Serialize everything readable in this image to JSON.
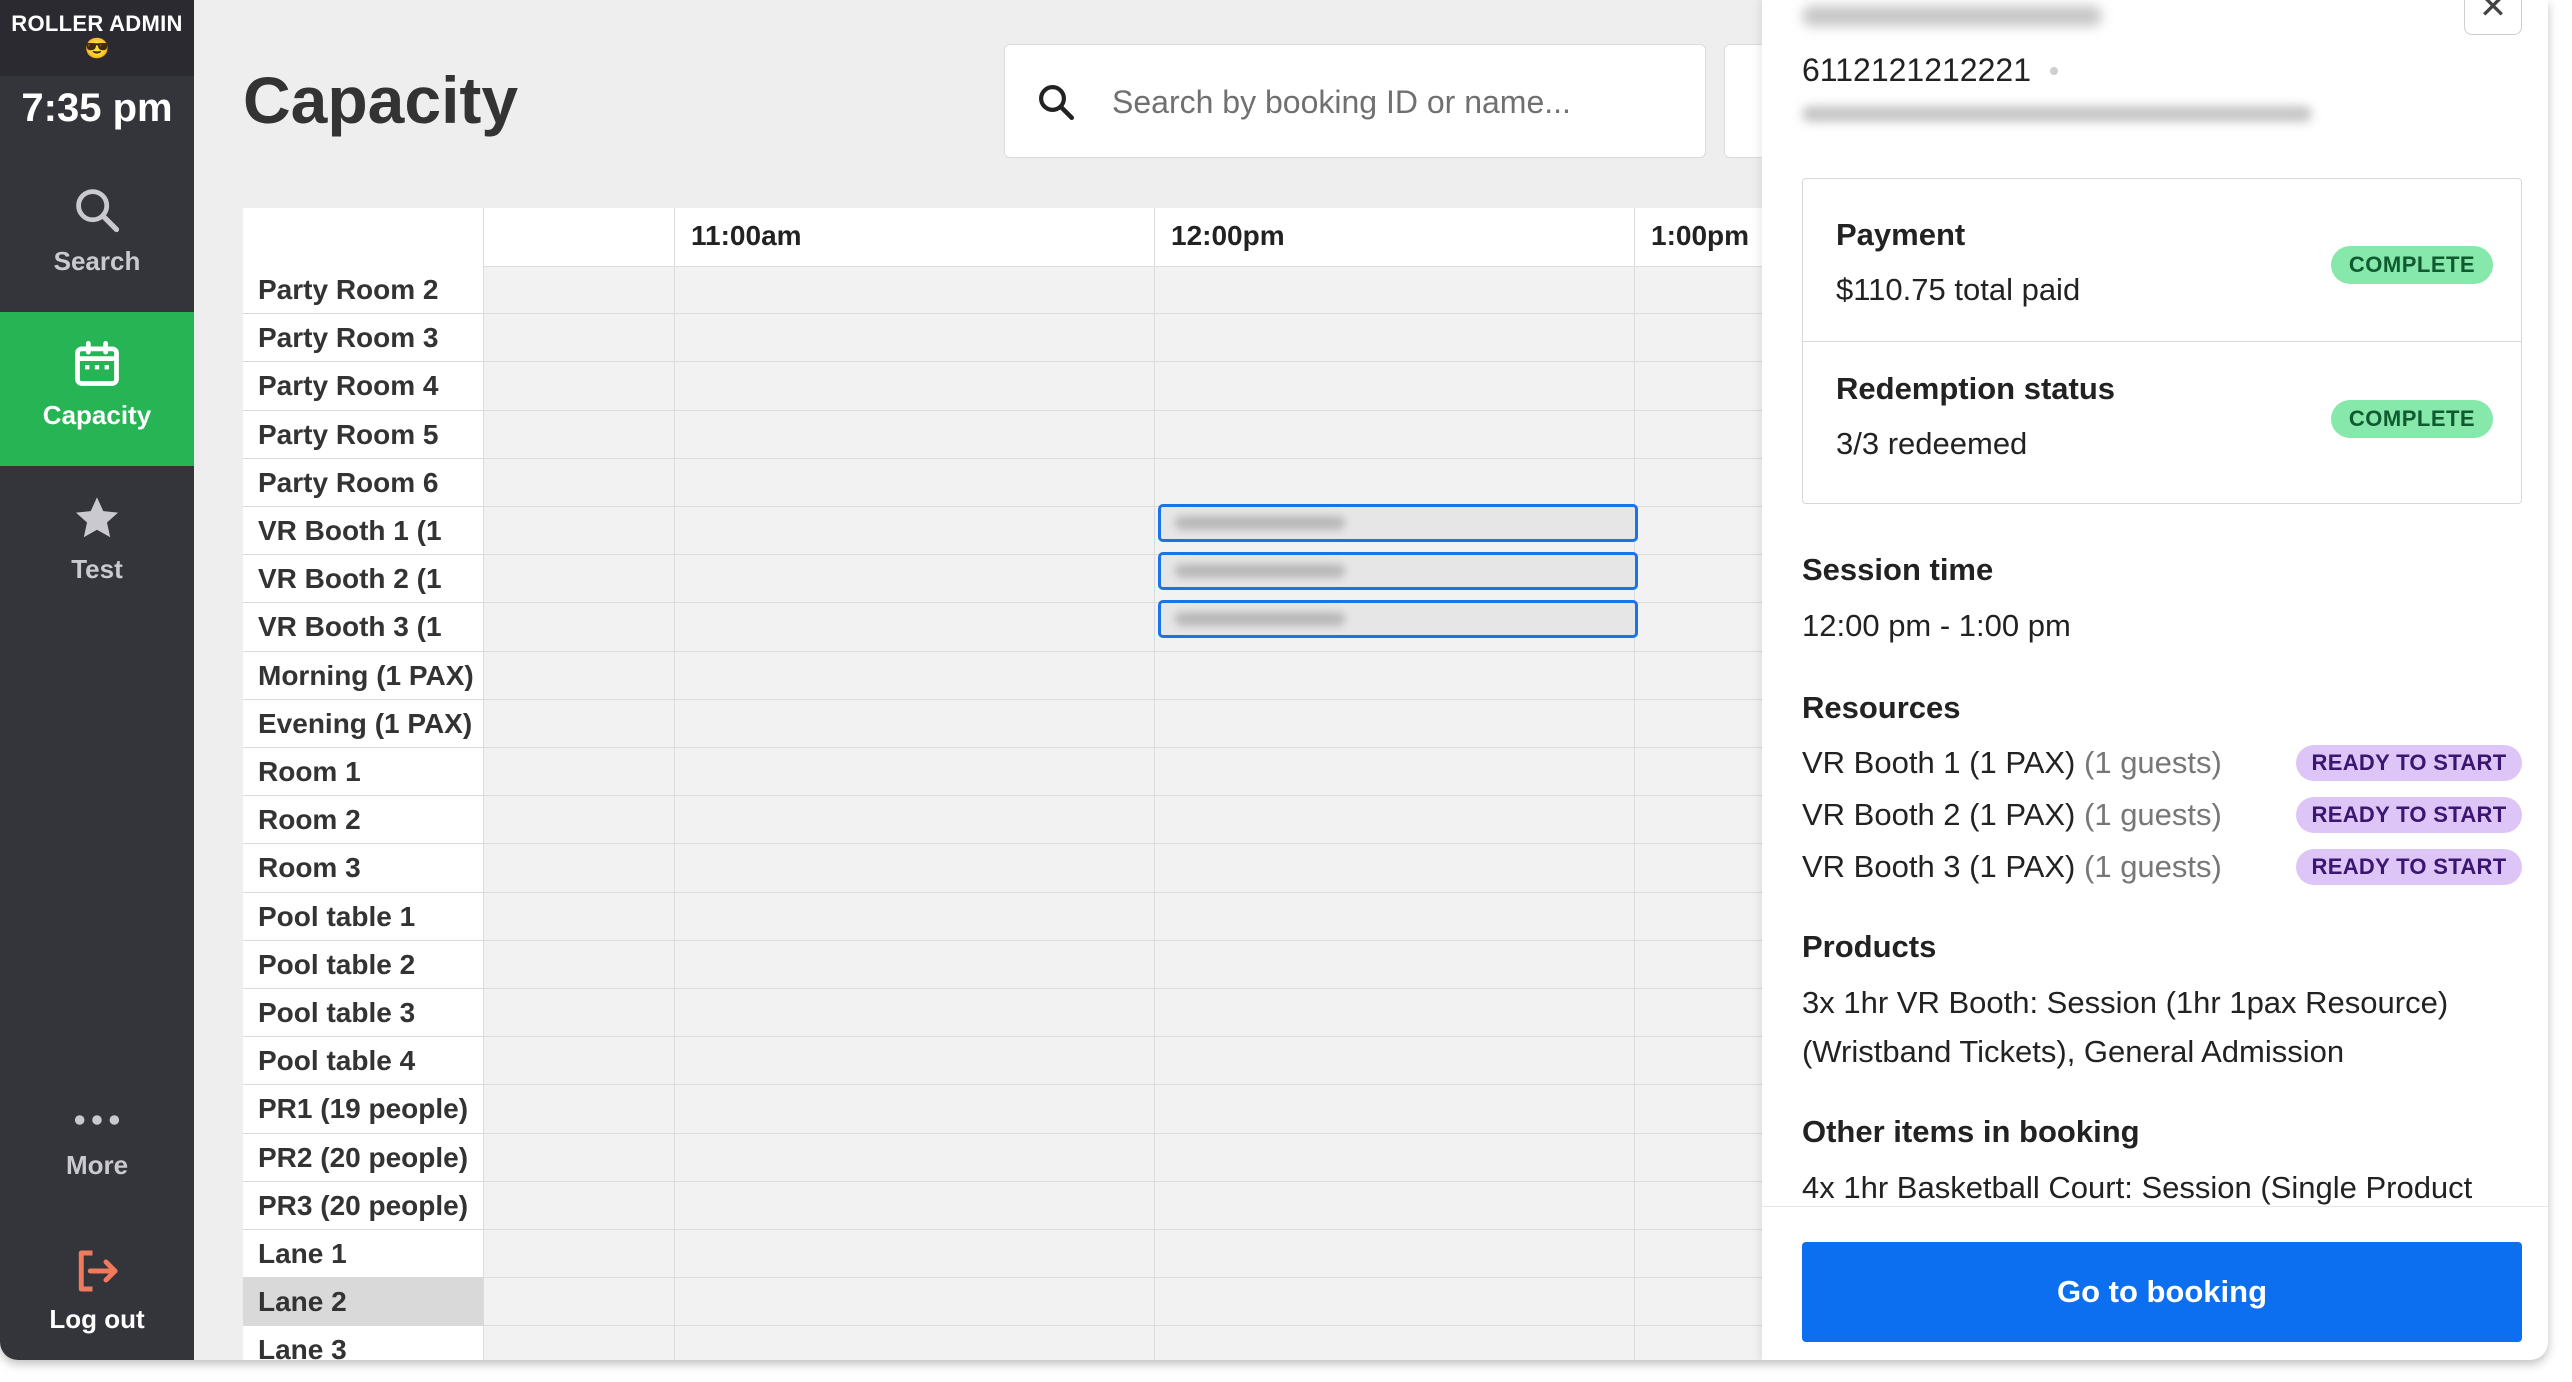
{
  "sidebar": {
    "brand": "ROLLER ADMIN",
    "brand_emoji": "😎",
    "time": "7:35 pm",
    "nav": {
      "search": "Search",
      "capacity": "Capacity",
      "test": "Test",
      "more": "More",
      "logout": "Log out"
    }
  },
  "header": {
    "title": "Capacity",
    "search_placeholder": "Search by booking ID or name..."
  },
  "grid": {
    "time_labels": [
      "11:00am",
      "12:00pm",
      "1:00pm"
    ],
    "rows": [
      "Party Room 2",
      "Party Room 3",
      "Party Room 4",
      "Party Room 5",
      "Party Room 6",
      "VR Booth 1 (1",
      "VR Booth 2 (1",
      "VR Booth 3 (1",
      "Morning (1 PAX)",
      "Evening (1 PAX)",
      "Room 1",
      "Room 2",
      "Room 3",
      "Pool table 1",
      "Pool table 2",
      "Pool table 3",
      "Pool table 4",
      "PR1 (19 people)",
      "PR2 (20 people)",
      "PR3 (20 people)",
      "Lane 1",
      "Lane 2",
      "Lane 3"
    ]
  },
  "panel": {
    "booking_id": "6112121212221",
    "payment_title": "Payment",
    "payment_value": "$110.75 total paid",
    "payment_status": "COMPLETE",
    "redemption_title": "Redemption status",
    "redemption_value": "3/3 redeemed",
    "redemption_status": "COMPLETE",
    "session_title": "Session time",
    "session_value": "12:00 pm - 1:00 pm",
    "resources_title": "Resources",
    "resources": [
      {
        "name": "VR Booth 1 (1 PAX)",
        "guests": "(1 guests)",
        "status": "READY TO START"
      },
      {
        "name": "VR Booth 2 (1 PAX)",
        "guests": "(1 guests)",
        "status": "READY TO START"
      },
      {
        "name": "VR Booth 3 (1 PAX)",
        "guests": "(1 guests)",
        "status": "READY TO START"
      }
    ],
    "products_title": "Products",
    "products_line1": "3x 1hr VR Booth: Session (1hr 1pax Resource)",
    "products_line2": "(Wristband Tickets), General Admission",
    "other_title": "Other items in booking",
    "other_line1": "4x 1hr Basketball Court: Session (Single Product",
    "button": "Go to booking",
    "close_glyph": "✕"
  }
}
